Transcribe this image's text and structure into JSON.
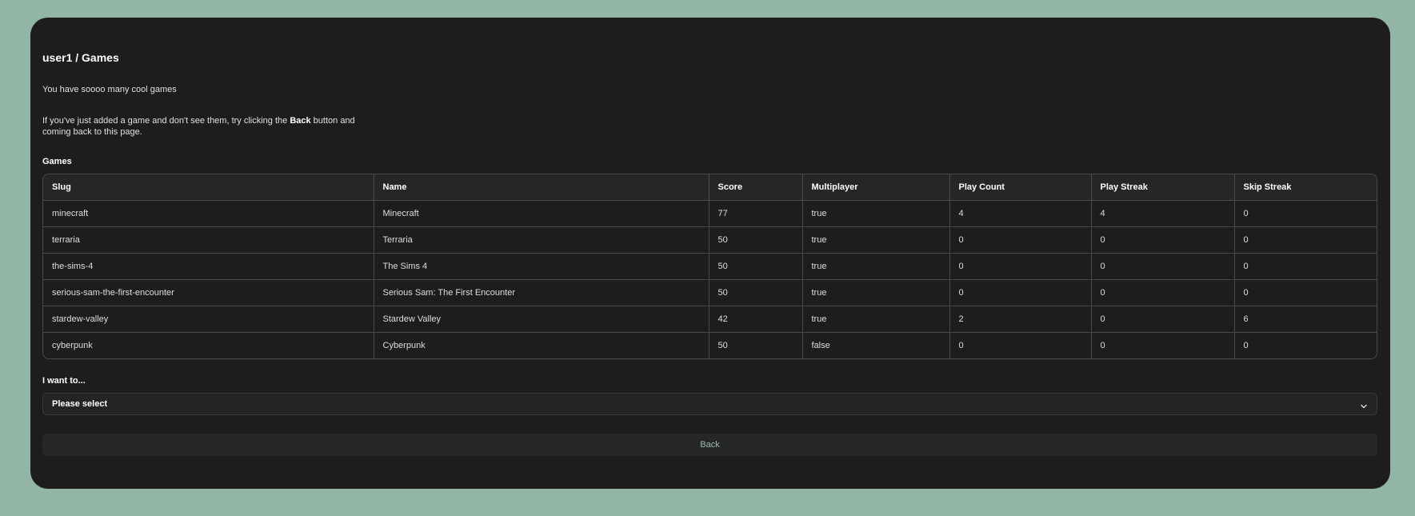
{
  "header": {
    "title": "user1 / Games"
  },
  "intro": {
    "text": "You have soooo many cool games"
  },
  "hint": {
    "before": "If you've just added a game and don't see them, try clicking the ",
    "bold": "Back",
    "after": " button and coming back to this page."
  },
  "games": {
    "label": "Games",
    "columns": [
      "Slug",
      "Name",
      "Score",
      "Multiplayer",
      "Play Count",
      "Play Streak",
      "Skip Streak"
    ],
    "rows": [
      [
        "minecraft",
        "Minecraft",
        "77",
        "true",
        "4",
        "4",
        "0"
      ],
      [
        "terraria",
        "Terraria",
        "50",
        "true",
        "0",
        "0",
        "0"
      ],
      [
        "the-sims-4",
        "The Sims 4",
        "50",
        "true",
        "0",
        "0",
        "0"
      ],
      [
        "serious-sam-the-first-encounter",
        "Serious Sam: The First Encounter",
        "50",
        "true",
        "0",
        "0",
        "0"
      ],
      [
        "stardew-valley",
        "Stardew Valley",
        "42",
        "true",
        "2",
        "0",
        "6"
      ],
      [
        "cyberpunk",
        "Cyberpunk",
        "50",
        "false",
        "0",
        "0",
        "0"
      ]
    ]
  },
  "action": {
    "label": "I want to...",
    "selected": "Please select",
    "icon": "chevron-down-icon"
  },
  "back_button": {
    "label": "Back"
  },
  "colors": {
    "background": "#93b5a6",
    "card": "#1d1d1d",
    "back_text": "#9fb8ae"
  }
}
